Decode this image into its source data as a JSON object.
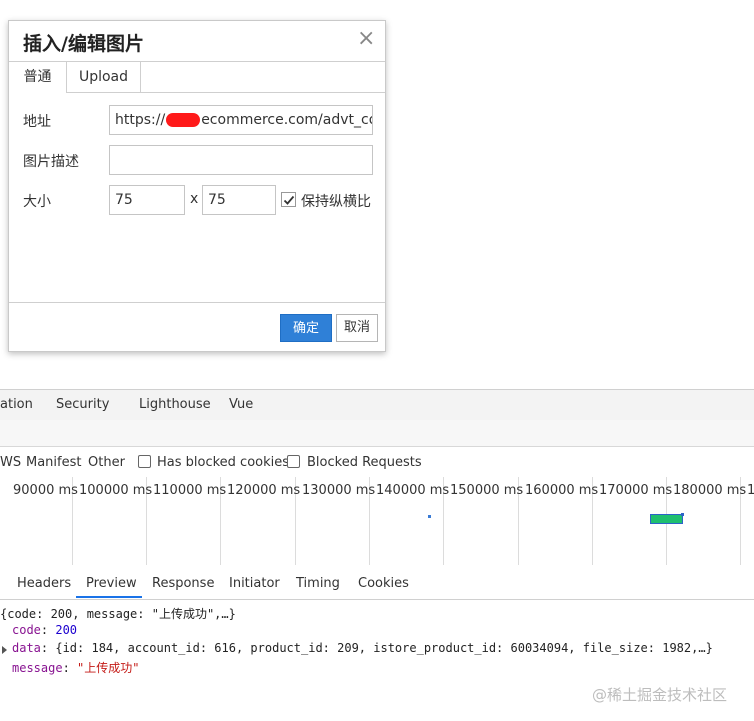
{
  "dialog": {
    "title": "插入/编辑图片",
    "tabs": [
      "普通",
      "Upload"
    ],
    "fields": {
      "url_label": "地址",
      "url_prefix": "https://",
      "url_suffix": "ecommerce.com/advt_coupai",
      "desc_label": "图片描述",
      "desc_value": "",
      "size_label": "大小",
      "width": "75",
      "height": "75",
      "size_sep": "x",
      "keep_ratio_label": "保持纵横比",
      "keep_ratio_checked": true
    },
    "ok_label": "确定",
    "cancel_label": "取消",
    "accent_color": "#2f80d7"
  },
  "devtools": {
    "tabs": [
      "ation",
      "Security",
      "Lighthouse",
      "Vue"
    ],
    "filters": {
      "types": [
        "WS",
        "Manifest",
        "Other"
      ],
      "checkboxes": [
        "Has blocked cookies",
        "Blocked Requests"
      ]
    },
    "timeline_ticks": [
      "90000 ms",
      "100000 ms",
      "110000 ms",
      "120000 ms",
      "130000 ms",
      "140000 ms",
      "150000 ms",
      "160000 ms",
      "170000 ms",
      "180000 ms",
      "1"
    ],
    "response_tabs": [
      "Headers",
      "Preview",
      "Response",
      "Initiator",
      "Timing",
      "Cookies"
    ],
    "active_response_tab": "Preview",
    "preview": {
      "summary": "{code: 200, message: \"上传成功\",…}",
      "code_key": "code",
      "code_value": "200",
      "data_key": "data",
      "data_value": "{id: 184, account_id: 616, product_id: 209, istore_product_id: 60034094, file_size: 1982,…}",
      "message_key": "message",
      "message_value": "\"上传成功\""
    }
  },
  "watermark": "@稀土掘金技术社区"
}
